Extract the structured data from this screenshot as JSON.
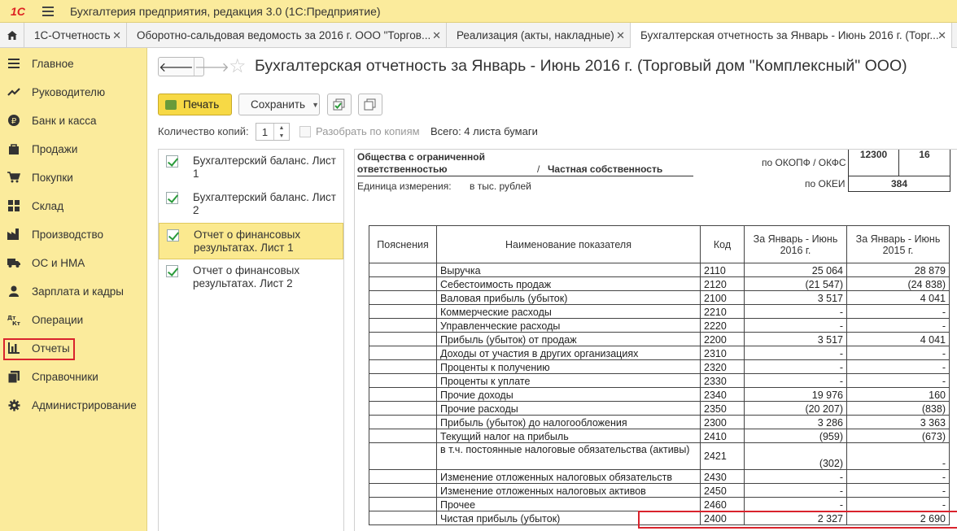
{
  "app": {
    "logo": "1С",
    "title": "Бухгалтерия предприятия, редакция 3.0  (1С:Предприятие)"
  },
  "tabs": [
    {
      "label": "1С-Отчетность"
    },
    {
      "label": "Оборотно-сальдовая ведомость за 2016 г. ООО \"Торгов..."
    },
    {
      "label": "Реализация (акты, накладные)"
    },
    {
      "label": "Бухгалтерская отчетность за Январь - Июнь 2016 г. (Торг..."
    }
  ],
  "sidebar": {
    "items": [
      {
        "label": "Главное",
        "icon": "list-icon"
      },
      {
        "label": "Руководителю",
        "icon": "trend-icon"
      },
      {
        "label": "Банк и касса",
        "icon": "ruble-icon"
      },
      {
        "label": "Продажи",
        "icon": "bag-icon"
      },
      {
        "label": "Покупки",
        "icon": "cart-icon"
      },
      {
        "label": "Склад",
        "icon": "grid-icon"
      },
      {
        "label": "Производство",
        "icon": "factory-icon"
      },
      {
        "label": "ОС и НМА",
        "icon": "truck-icon"
      },
      {
        "label": "Зарплата и кадры",
        "icon": "person-icon"
      },
      {
        "label": "Операции",
        "icon": "dt-kt-icon"
      },
      {
        "label": "Отчеты",
        "icon": "bar-chart-icon"
      },
      {
        "label": "Справочники",
        "icon": "books-icon"
      },
      {
        "label": "Администрирование",
        "icon": "gear-icon"
      }
    ],
    "dtkt_glyph": "Дт Кт"
  },
  "document": {
    "title": "Бухгалтерская отчетность за Январь - Июнь 2016 г. (Торговый дом \"Комплексный\" ООО)",
    "print_label": "Печать",
    "save_label": "Сохранить",
    "copies_label": "Количество копий:",
    "copies_value": "1",
    "sort_label": "Разобрать по копиям",
    "total_label": "Всего: 4 листа бумаги"
  },
  "sheets": [
    {
      "label": "Бухгалтерский баланс. Лист 1",
      "checked": true
    },
    {
      "label": "Бухгалтерский баланс. Лист 2",
      "checked": true
    },
    {
      "label": "Отчет о финансовых результатах. Лист 1",
      "checked": true
    },
    {
      "label": "Отчет о финансовых результатах. Лист 2",
      "checked": true
    }
  ],
  "report": {
    "org_form_line1": "Общества с ограниченной",
    "org_form_line2": "ответственностью",
    "slash": "/",
    "ownership": "Частная собственность",
    "unit_label": "Единица измерения:",
    "unit_value": "в тыс. рублей",
    "okopf_label": "по ОКОПФ / ОКФС",
    "okopf_code": "12300",
    "okfs_code": "16",
    "okei_label": "по ОКЕИ",
    "okei_code": "384",
    "headers": {
      "notes": "Пояснения",
      "name": "Наименование показателя",
      "code": "Код",
      "cur": "За Январь - Июнь 2016 г.",
      "prev": "За Январь - Июнь 2015 г."
    },
    "rows": [
      {
        "name": "Выручка",
        "code": "2110",
        "cur": "25 064",
        "prev": "28 879"
      },
      {
        "name": "Себестоимость продаж",
        "code": "2120",
        "cur": "(21 547)",
        "prev": "(24 838)"
      },
      {
        "name": "Валовая прибыль (убыток)",
        "code": "2100",
        "cur": "3 517",
        "prev": "4 041"
      },
      {
        "name": "Коммерческие расходы",
        "code": "2210",
        "cur": "-",
        "prev": "-"
      },
      {
        "name": "Управленческие расходы",
        "code": "2220",
        "cur": "-",
        "prev": "-"
      },
      {
        "name": "Прибыль (убыток) от продаж",
        "code": "2200",
        "cur": "3 517",
        "prev": "4 041",
        "indent": true
      },
      {
        "name": "Доходы от участия в других организациях",
        "code": "2310",
        "cur": "-",
        "prev": "-"
      },
      {
        "name": "Проценты к получению",
        "code": "2320",
        "cur": "-",
        "prev": "-"
      },
      {
        "name": "Проценты к уплате",
        "code": "2330",
        "cur": "-",
        "prev": "-"
      },
      {
        "name": "Прочие доходы",
        "code": "2340",
        "cur": "19 976",
        "prev": "160"
      },
      {
        "name": "Прочие расходы",
        "code": "2350",
        "cur": "(20 207)",
        "prev": "(838)"
      },
      {
        "name": "Прибыль (убыток) до налогообложения",
        "code": "2300",
        "cur": "3 286",
        "prev": "3 363",
        "indent": true
      },
      {
        "name": "Текущий налог на прибыль",
        "code": "2410",
        "cur": "(959)",
        "prev": "(673)"
      },
      {
        "name": "в т.ч. постоянные налоговые обязательства (активы)",
        "code": "2421",
        "cur": "(302)",
        "prev": "-",
        "indent": true,
        "tall": true
      },
      {
        "name": "Изменение отложенных налоговых обязательств",
        "code": "2430",
        "cur": "-",
        "prev": "-"
      },
      {
        "name": "Изменение отложенных налоговых активов",
        "code": "2450",
        "cur": "-",
        "prev": "-"
      },
      {
        "name": "Прочее",
        "code": "2460",
        "cur": "-",
        "prev": "-"
      },
      {
        "name": "Чистая прибыль (убыток)",
        "code": "2400",
        "cur": "2 327",
        "prev": "2 690",
        "indent": true
      }
    ]
  },
  "colors": {
    "accent": "#fbeb9c",
    "highlight": "#d9232d",
    "print_button": "#f7d945"
  }
}
